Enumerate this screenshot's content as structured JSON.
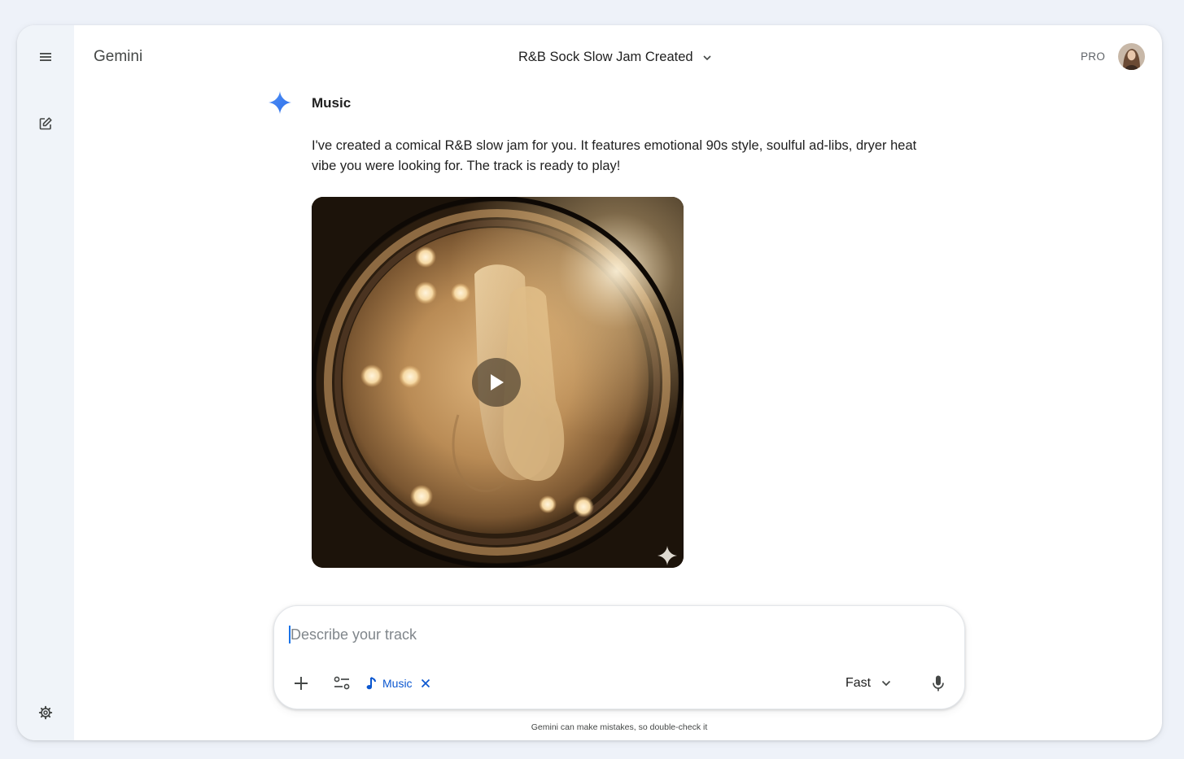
{
  "app": {
    "name": "Gemini",
    "plan_badge": "PRO"
  },
  "conversation": {
    "title": "R&B Sock Slow Jam Created"
  },
  "response": {
    "model_label": "Music",
    "text": "I've created a comical R&B slow jam for you. It features emotional 90s style, soulful ad-libs, dryer heat vibe you were looking for. The track is ready to play!"
  },
  "composer": {
    "placeholder": "Describe your track",
    "value": "",
    "tool_chip_label": "Music",
    "mode_label": "Fast"
  },
  "footer": {
    "disclaimer": "Gemini can make mistakes, so double-check it"
  },
  "colors": {
    "accent": "#0b57d0",
    "rail_bg": "#f0f4f9",
    "spark_blue": "#4285f4"
  },
  "icons": {
    "rail": [
      "menu-icon",
      "new-chat-icon",
      "settings-icon"
    ],
    "composer": [
      "plus-icon",
      "tools-icon",
      "music-note-icon",
      "close-icon",
      "chevron-down-icon",
      "mic-icon"
    ]
  }
}
